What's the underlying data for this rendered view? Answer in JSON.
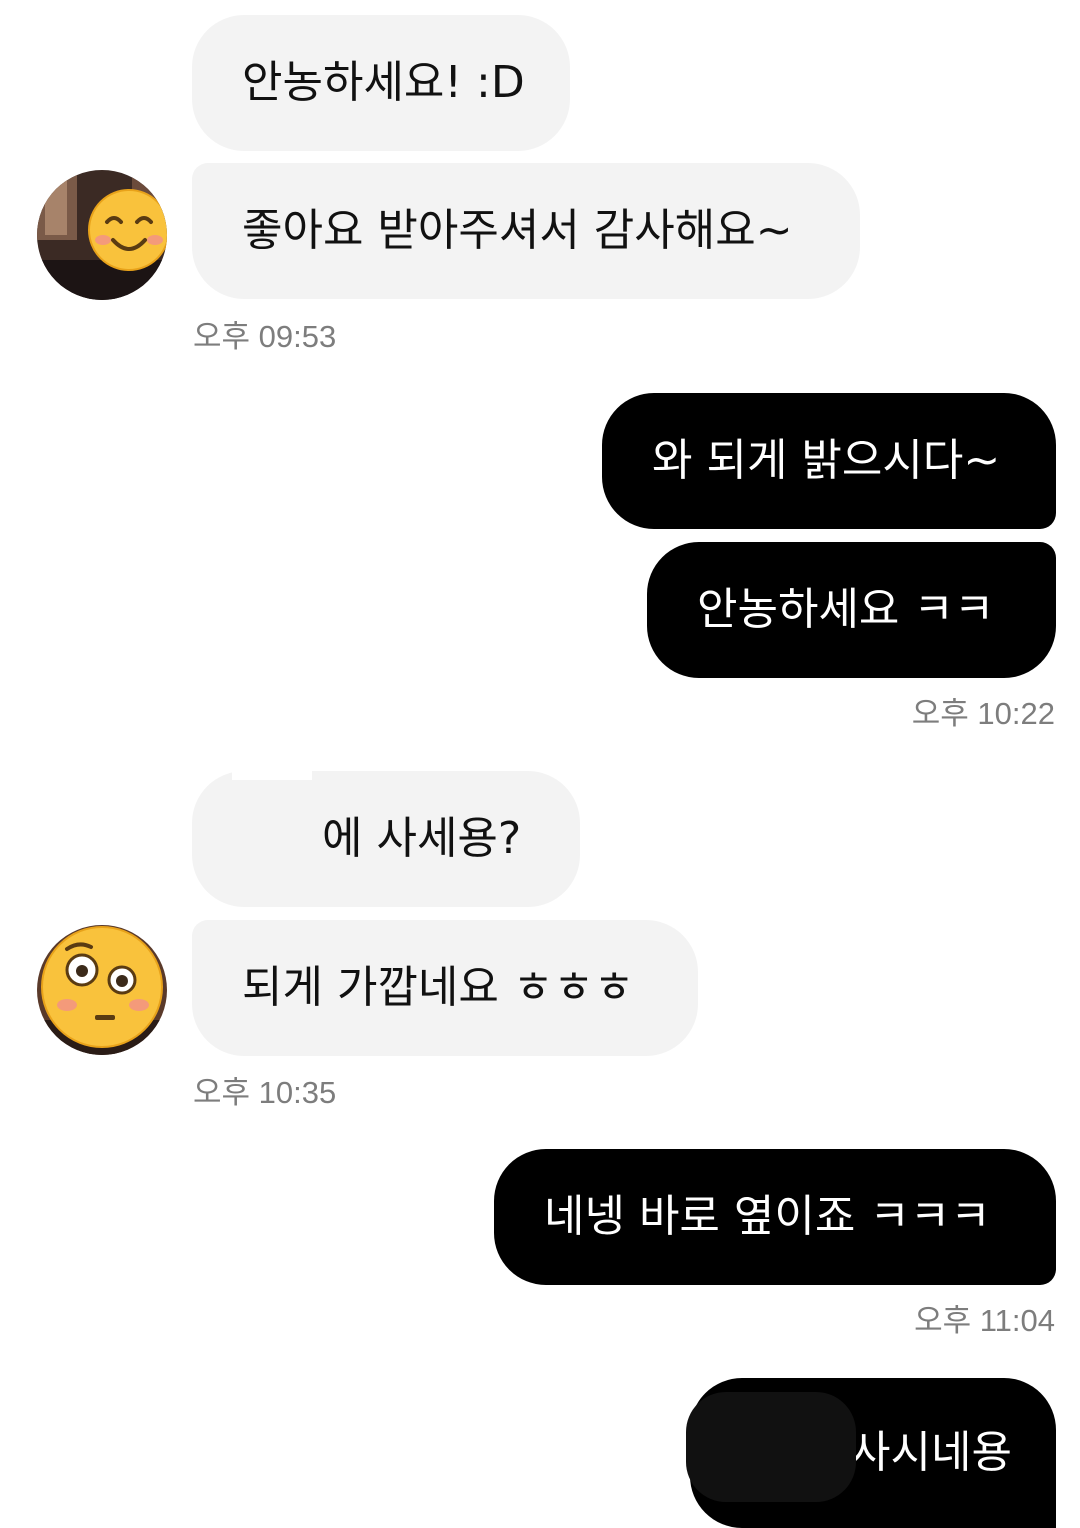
{
  "chat": {
    "messages": [
      {
        "side": "in",
        "text": "안농하세요! :D"
      },
      {
        "side": "in",
        "text": "좋아요 받아주셔서 감사해요~"
      },
      {
        "side": "out",
        "text": "와 되게 밝으시다~"
      },
      {
        "side": "out",
        "text": "안농하세요 ㅋㅋ"
      },
      {
        "side": "in",
        "text": "에 사세용?"
      },
      {
        "side": "in",
        "text": "되게 가깝네요 ㅎㅎㅎ"
      },
      {
        "side": "out",
        "text": "네넹 바로 옆이죠 ㅋㅋㅋ"
      },
      {
        "side": "out",
        "text": "사시네용"
      }
    ],
    "timestamps": [
      "오후 09:53",
      "오후 10:22",
      "오후 10:35",
      "오후 11:04"
    ],
    "avatars": [
      {
        "icon": "smiling-face-emoji-avatar-icon"
      },
      {
        "icon": "flushed-face-emoji-avatar-icon"
      }
    ]
  },
  "colors": {
    "incoming_bubble": "#f3f3f3",
    "outgoing_bubble": "#000000",
    "timestamp": "#7d7d7d"
  }
}
